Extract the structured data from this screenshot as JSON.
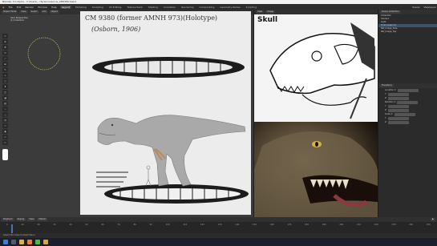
{
  "window": {
    "title": "Blender 3.0 Alpha - C:\\Users\\...\\Tyrannosaurus_CM9380.blend"
  },
  "menu": {
    "items": [
      "File",
      "Edit",
      "Render",
      "Window",
      "Help"
    ],
    "workspaces": [
      "Layout",
      "Modeling",
      "Sculpting",
      "UV Editing",
      "Texture Paint",
      "Shading",
      "Animation",
      "Rendering",
      "Compositing",
      "Geometry Nodes",
      "Scripting"
    ],
    "active_workspace": "Layout",
    "scene_label": "Scene",
    "view_layer_label": "ViewLayer"
  },
  "viewport_left": {
    "mode": "Object Mode",
    "header_items": [
      "View",
      "Select",
      "Add",
      "Object"
    ],
    "overlay_text": "User Perspective",
    "collection_text": "(1) Collection",
    "ref_caption_line1": "CM 9380 (former AMNH 973)(Holotype)",
    "ref_caption_line2": "(Osborn, 1906)"
  },
  "viewport_top_right": {
    "header_items": [
      "View",
      "Image"
    ],
    "ref_label": "Skull"
  },
  "outliner": {
    "title": "Scene Collection",
    "rows": [
      "Collection",
      "Camera",
      "Light",
      "Tyrannosaurus",
      "Ref_Image_Side",
      "Ref_Image_Top"
    ]
  },
  "properties": {
    "section": "Transform",
    "rows": [
      "Location X",
      "Y",
      "Z",
      "Rotation X",
      "Y",
      "Z",
      "Scale X",
      "Y",
      "Z"
    ]
  },
  "timeline": {
    "header_items": [
      "Playback",
      "Keying",
      "View",
      "Marker"
    ],
    "ticks": [
      "0",
      "10",
      "20",
      "30",
      "40",
      "50",
      "60",
      "70",
      "80",
      "90",
      "100",
      "110",
      "120",
      "130",
      "140",
      "150",
      "160",
      "170",
      "180",
      "190",
      "200",
      "210",
      "220",
      "230",
      "240",
      "250"
    ]
  },
  "statusbar": {
    "text": "Select   Pan View   Context Menu"
  },
  "colors": {
    "accent": "#3b4f6e",
    "active": "#4772b3"
  },
  "icons": {
    "taskbar": [
      "windows-icon",
      "search-icon",
      "explorer-icon",
      "blender-icon",
      "chrome-icon",
      "folder-icon"
    ]
  }
}
